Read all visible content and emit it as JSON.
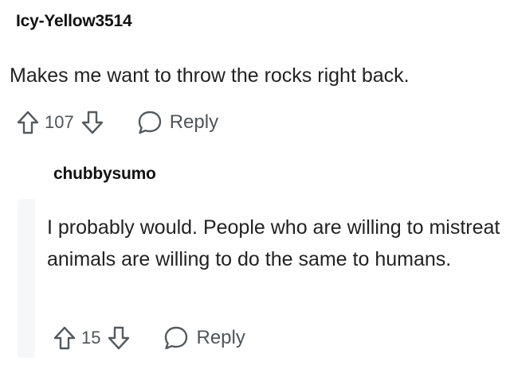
{
  "comments": [
    {
      "author": "Icy-Yellow3514",
      "body": "Makes me want to throw the rocks right back.",
      "score": "107",
      "reply_label": "Reply"
    },
    {
      "author": "chubbysumo",
      "body": "I probably would. People who are willing to mistreat animals are willing to do the same to humans.",
      "score": "15",
      "reply_label": "Reply"
    }
  ],
  "icons": {
    "upvote": "arrow-up-outline-icon",
    "downvote": "arrow-down-outline-icon",
    "reply": "speech-bubble-icon"
  }
}
